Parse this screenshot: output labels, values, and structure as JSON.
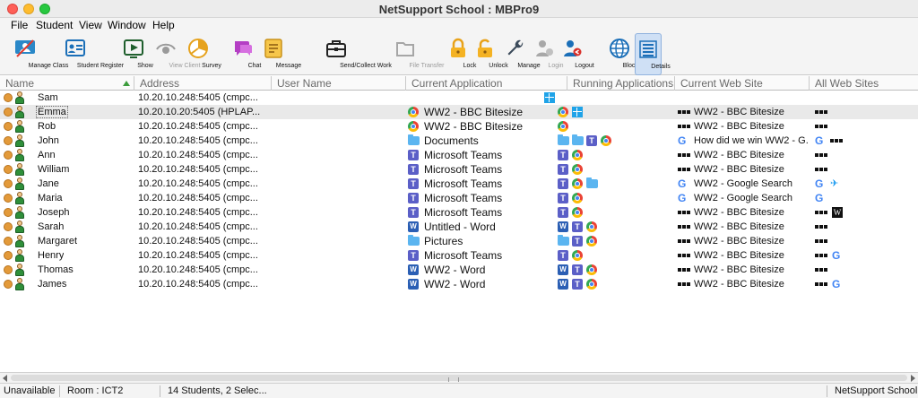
{
  "window": {
    "title": "NetSupport School : MBPro9"
  },
  "menu": [
    "File",
    "Student",
    "View",
    "Window",
    "Help"
  ],
  "toolbar": [
    {
      "label": "Manage Class",
      "icon": "manage-class-icon",
      "enabled": true
    },
    {
      "label": "Student Register",
      "icon": "student-register-icon",
      "enabled": true
    },
    {
      "label": "Show",
      "icon": "show-icon",
      "enabled": true
    },
    {
      "label": "View Client",
      "icon": "view-client-icon",
      "enabled": false
    },
    {
      "label": "Survey",
      "icon": "survey-icon",
      "enabled": true
    },
    {
      "label": "Chat",
      "icon": "chat-icon",
      "enabled": true
    },
    {
      "label": "Message",
      "icon": "message-icon",
      "enabled": true
    },
    {
      "label": "Send/Collect Work",
      "icon": "briefcase-icon",
      "enabled": true
    },
    {
      "label": "File Transfer",
      "icon": "file-transfer-icon",
      "enabled": false
    },
    {
      "label": "Lock",
      "icon": "lock-icon",
      "enabled": true
    },
    {
      "label": "Unlock",
      "icon": "unlock-icon",
      "enabled": true
    },
    {
      "label": "Manage",
      "icon": "wrench-icon",
      "enabled": true
    },
    {
      "label": "Login",
      "icon": "login-icon",
      "enabled": false
    },
    {
      "label": "Logout",
      "icon": "logout-icon",
      "enabled": true
    },
    {
      "label": "Block All",
      "icon": "globe-icon",
      "enabled": true
    },
    {
      "label": "Details",
      "icon": "details-view-icon",
      "enabled": true,
      "active": true
    }
  ],
  "columns": [
    "Name",
    "Address",
    "User Name",
    "Current Application",
    "Running Applications",
    "Current Web Site",
    "All Web Sites"
  ],
  "students": [
    {
      "name": "Sam",
      "address": "10.20.10.248:5405 (cmpc...",
      "current_app": {
        "label": "",
        "icon": ""
      },
      "running_apps": [
        "windows-icon"
      ],
      "current_site": {
        "label": "",
        "icon": ""
      },
      "all_sites": []
    },
    {
      "name": "Emma",
      "address": "10.20.10.20:5405 (HPLAP...",
      "selected": true,
      "current_app": {
        "label": "WW2 - BBC Bitesize",
        "icon": "chrome-icon"
      },
      "running_apps": [
        "chrome-icon",
        "windows-icon"
      ],
      "current_site": {
        "label": "WW2 - BBC Bitesize",
        "icon": "bbc-icon"
      },
      "all_sites": [
        "bbc-icon"
      ]
    },
    {
      "name": "Rob",
      "address": "10.20.10.248:5405 (cmpc...",
      "current_app": {
        "label": "WW2 - BBC Bitesize",
        "icon": "chrome-icon"
      },
      "running_apps": [
        "chrome-icon"
      ],
      "current_site": {
        "label": "WW2 - BBC Bitesize",
        "icon": "bbc-icon"
      },
      "all_sites": [
        "bbc-icon"
      ]
    },
    {
      "name": "John",
      "address": "10.20.10.248:5405 (cmpc...",
      "current_app": {
        "label": "Documents",
        "icon": "folder-icon"
      },
      "running_apps": [
        "folder-icon",
        "folder-icon",
        "teams-icon",
        "chrome-icon"
      ],
      "current_site": {
        "label": "How did we win WW2 - G...",
        "icon": "google-icon"
      },
      "all_sites": [
        "google-icon",
        "bbc-icon"
      ]
    },
    {
      "name": "Ann",
      "address": "10.20.10.248:5405 (cmpc...",
      "current_app": {
        "label": "Microsoft Teams",
        "icon": "teams-icon"
      },
      "running_apps": [
        "teams-icon",
        "chrome-icon"
      ],
      "current_site": {
        "label": "WW2 - BBC Bitesize",
        "icon": "bbc-icon"
      },
      "all_sites": [
        "bbc-icon"
      ]
    },
    {
      "name": "William",
      "address": "10.20.10.248:5405 (cmpc...",
      "current_app": {
        "label": "Microsoft Teams",
        "icon": "teams-icon"
      },
      "running_apps": [
        "teams-icon",
        "chrome-icon"
      ],
      "current_site": {
        "label": "WW2 - BBC Bitesize",
        "icon": "bbc-icon"
      },
      "all_sites": [
        "bbc-icon"
      ]
    },
    {
      "name": "Jane",
      "address": "10.20.10.248:5405 (cmpc...",
      "current_app": {
        "label": "Microsoft Teams",
        "icon": "teams-icon"
      },
      "running_apps": [
        "teams-icon",
        "chrome-icon",
        "folder-icon"
      ],
      "current_site": {
        "label": "WW2 - Google Search",
        "icon": "google-icon"
      },
      "all_sites": [
        "google-icon",
        "twitter-icon"
      ]
    },
    {
      "name": "Maria",
      "address": "10.20.10.248:5405 (cmpc...",
      "current_app": {
        "label": "Microsoft Teams",
        "icon": "teams-icon"
      },
      "running_apps": [
        "teams-icon",
        "chrome-icon"
      ],
      "current_site": {
        "label": "WW2 - Google Search",
        "icon": "google-icon"
      },
      "all_sites": [
        "google-icon"
      ]
    },
    {
      "name": "Joseph",
      "address": "10.20.10.248:5405 (cmpc...",
      "current_app": {
        "label": "Microsoft Teams",
        "icon": "teams-icon"
      },
      "running_apps": [
        "teams-icon",
        "chrome-icon"
      ],
      "current_site": {
        "label": "WW2 - BBC Bitesize",
        "icon": "bbc-icon"
      },
      "all_sites": [
        "bbc-icon",
        "wikipedia-icon"
      ]
    },
    {
      "name": "Sarah",
      "address": "10.20.10.248:5405 (cmpc...",
      "current_app": {
        "label": "Untitled - Word",
        "icon": "word-icon"
      },
      "running_apps": [
        "word-icon",
        "teams-icon",
        "chrome-icon"
      ],
      "current_site": {
        "label": "WW2 - BBC Bitesize",
        "icon": "bbc-icon"
      },
      "all_sites": [
        "bbc-icon"
      ]
    },
    {
      "name": "Margaret",
      "address": "10.20.10.248:5405 (cmpc...",
      "current_app": {
        "label": "Pictures",
        "icon": "folder-icon"
      },
      "running_apps": [
        "folder-icon",
        "teams-icon",
        "chrome-icon"
      ],
      "current_site": {
        "label": "WW2 - BBC Bitesize",
        "icon": "bbc-icon"
      },
      "all_sites": [
        "bbc-icon"
      ]
    },
    {
      "name": "Henry",
      "address": "10.20.10.248:5405 (cmpc...",
      "current_app": {
        "label": "Microsoft Teams",
        "icon": "teams-icon"
      },
      "running_apps": [
        "teams-icon",
        "chrome-icon"
      ],
      "current_site": {
        "label": "WW2 - BBC Bitesize",
        "icon": "bbc-icon"
      },
      "all_sites": [
        "bbc-icon",
        "google-icon"
      ]
    },
    {
      "name": "Thomas",
      "address": "10.20.10.248:5405 (cmpc...",
      "current_app": {
        "label": "WW2 - Word",
        "icon": "word-icon"
      },
      "running_apps": [
        "word-icon",
        "teams-icon",
        "chrome-icon"
      ],
      "current_site": {
        "label": "WW2 - BBC Bitesize",
        "icon": "bbc-icon"
      },
      "all_sites": [
        "bbc-icon"
      ]
    },
    {
      "name": "James",
      "address": "10.20.10.248:5405 (cmpc...",
      "current_app": {
        "label": "WW2 - Word",
        "icon": "word-icon"
      },
      "running_apps": [
        "word-icon",
        "teams-icon",
        "chrome-icon"
      ],
      "current_site": {
        "label": "WW2 - BBC Bitesize",
        "icon": "bbc-icon"
      },
      "all_sites": [
        "bbc-icon",
        "google-icon"
      ]
    }
  ],
  "status": {
    "state": "Unavailable",
    "room": "Room : ICT2",
    "selection": "14 Students, 2 Selec...",
    "product": "NetSupport School"
  }
}
